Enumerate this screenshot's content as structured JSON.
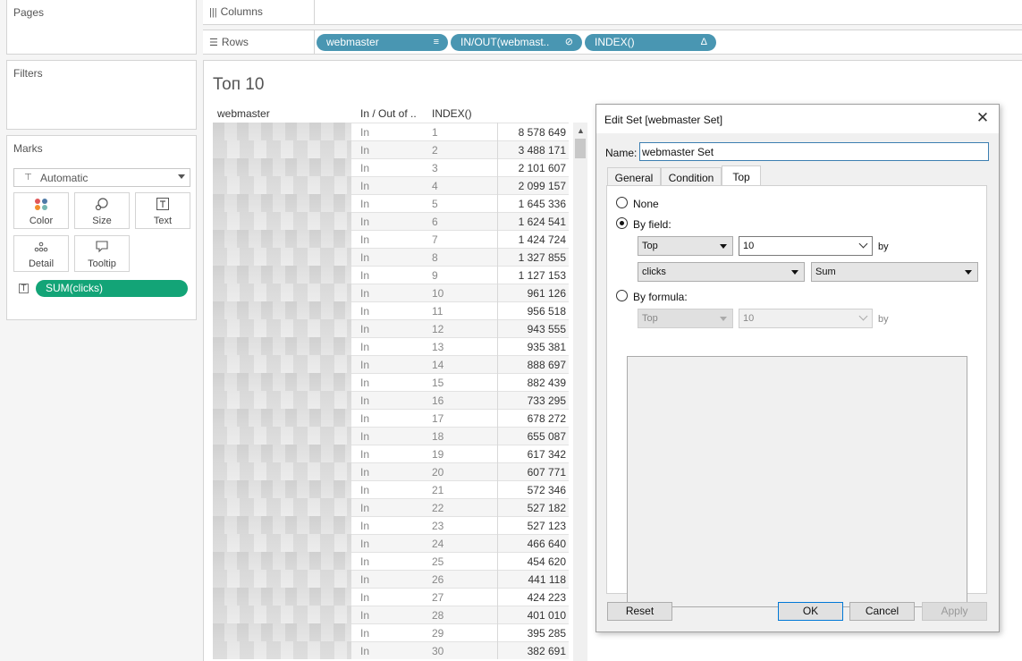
{
  "shelves": {
    "pages_label": "Pages",
    "filters_label": "Filters",
    "marks_label": "Marks",
    "columns_label": "Columns",
    "rows_label": "Rows",
    "row_pills": [
      {
        "label": "webmaster",
        "icon": "sort-icon"
      },
      {
        "label": "IN/OUT(webmast..",
        "icon": "set-icon"
      },
      {
        "label": "INDEX()",
        "icon": "delta-icon"
      }
    ]
  },
  "marks": {
    "type": "Automatic",
    "buttons": [
      {
        "label": "Color",
        "icon": "color-dots-icon"
      },
      {
        "label": "Size",
        "icon": "size-icon"
      },
      {
        "label": "Text",
        "icon": "text-icon"
      },
      {
        "label": "Detail",
        "icon": "detail-icon"
      },
      {
        "label": "Tooltip",
        "icon": "tooltip-icon"
      }
    ],
    "field_pill": "SUM(clicks)"
  },
  "view": {
    "title": "Топ 10",
    "headers": {
      "webmaster": "webmaster",
      "inout": "In / Out of ..",
      "index": "INDEX()"
    },
    "rows": [
      {
        "inout": "In",
        "index": "1",
        "value": "8 578 649"
      },
      {
        "inout": "In",
        "index": "2",
        "value": "3 488 171"
      },
      {
        "inout": "In",
        "index": "3",
        "value": "2 101 607"
      },
      {
        "inout": "In",
        "index": "4",
        "value": "2 099 157"
      },
      {
        "inout": "In",
        "index": "5",
        "value": "1 645 336"
      },
      {
        "inout": "In",
        "index": "6",
        "value": "1 624 541"
      },
      {
        "inout": "In",
        "index": "7",
        "value": "1 424 724"
      },
      {
        "inout": "In",
        "index": "8",
        "value": "1 327 855"
      },
      {
        "inout": "In",
        "index": "9",
        "value": "1 127 153"
      },
      {
        "inout": "In",
        "index": "10",
        "value": "961 126"
      },
      {
        "inout": "In",
        "index": "11",
        "value": "956 518"
      },
      {
        "inout": "In",
        "index": "12",
        "value": "943 555"
      },
      {
        "inout": "In",
        "index": "13",
        "value": "935 381"
      },
      {
        "inout": "In",
        "index": "14",
        "value": "888 697"
      },
      {
        "inout": "In",
        "index": "15",
        "value": "882 439"
      },
      {
        "inout": "In",
        "index": "16",
        "value": "733 295"
      },
      {
        "inout": "In",
        "index": "17",
        "value": "678 272"
      },
      {
        "inout": "In",
        "index": "18",
        "value": "655 087"
      },
      {
        "inout": "In",
        "index": "19",
        "value": "617 342"
      },
      {
        "inout": "In",
        "index": "20",
        "value": "607 771"
      },
      {
        "inout": "In",
        "index": "21",
        "value": "572 346"
      },
      {
        "inout": "In",
        "index": "22",
        "value": "527 182"
      },
      {
        "inout": "In",
        "index": "23",
        "value": "527 123"
      },
      {
        "inout": "In",
        "index": "24",
        "value": "466 640"
      },
      {
        "inout": "In",
        "index": "25",
        "value": "454 620"
      },
      {
        "inout": "In",
        "index": "26",
        "value": "441 118"
      },
      {
        "inout": "In",
        "index": "27",
        "value": "424 223"
      },
      {
        "inout": "In",
        "index": "28",
        "value": "401 010"
      },
      {
        "inout": "In",
        "index": "29",
        "value": "395 285"
      },
      {
        "inout": "In",
        "index": "30",
        "value": "382 691"
      }
    ]
  },
  "dialog": {
    "title": "Edit Set [webmaster Set]",
    "name_label": "Name:",
    "name_value": "webmaster Set",
    "tabs": [
      "General",
      "Condition",
      "Top"
    ],
    "active_tab": "Top",
    "none_label": "None",
    "by_field_label": "By field:",
    "by_formula_label": "By formula:",
    "field_top": "Top",
    "field_count": "10",
    "field_by": "by",
    "field_measure": "clicks",
    "field_agg": "Sum",
    "formula_top": "Top",
    "formula_count": "10",
    "formula_by": "by",
    "buttons": {
      "reset": "Reset",
      "ok": "OK",
      "cancel": "Cancel",
      "apply": "Apply"
    }
  },
  "colors": {
    "pill_green": "#13a477",
    "pill_blue": "#4996b2",
    "focus_blue": "#0078d7"
  }
}
